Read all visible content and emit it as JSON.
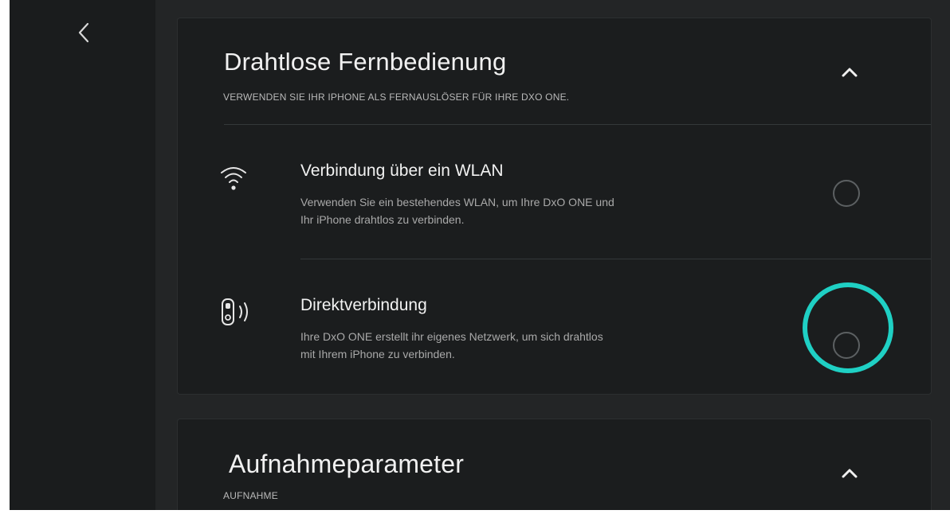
{
  "nav": {
    "back_icon": "chevron-left-icon"
  },
  "section_remote": {
    "title": "Drahtlose Fernbedienung",
    "subtitle": "VERWENDEN SIE IHR IPHONE ALS FERNAUSLÖSER FÜR IHRE DXO ONE.",
    "collapse_icon": "chevron-up-icon",
    "options": [
      {
        "icon": "wifi-icon",
        "title": "Verbindung über ein WLAN",
        "description_lines": [
          "Verwenden Sie ein bestehendes WLAN, um Ihre DxO ONE und",
          "Ihr iPhone drahtlos zu verbinden."
        ],
        "selected": false
      },
      {
        "icon": "camera-wireless-icon",
        "title": "Direktverbindung",
        "description_lines": [
          "Ihre DxO ONE erstellt ihr eigenes Netzwerk, um sich drahtlos",
          " mit Ihrem iPhone zu verbinden."
        ],
        "selected": false
      }
    ]
  },
  "section_capture": {
    "title": "Aufnahmeparameter",
    "subtitle": "AUFNAHME",
    "collapse_icon": "chevron-up-icon"
  },
  "colors": {
    "background": "#222425",
    "card": "#1b1d1e",
    "highlight": "#1fd0c4",
    "text_primary": "#f2f2f2",
    "text_secondary": "#a9a9a9"
  }
}
